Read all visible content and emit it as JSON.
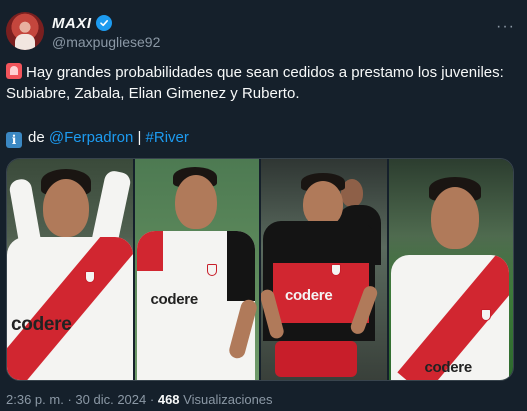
{
  "author": {
    "display_name": "MAXI",
    "handle": "@maxpugliese92",
    "verified_icon": "verified-badge-icon",
    "more_label": "···"
  },
  "tweet": {
    "siren_emoji": "rotating-light-emoji",
    "text": "Hay grandes probabilidades que sean cedidos a prestamo los juveniles: Subiabre, Zabala, Elian Gimenez y Ruberto.",
    "info_emoji": "i",
    "credit_prefix": "de",
    "credit_mention": "@Ferpadron",
    "credit_separator": "|",
    "credit_hashtag": "#River"
  },
  "media": {
    "sponsor": "codere"
  },
  "meta": {
    "time": "2:36 p. m.",
    "separator": "·",
    "date": "30 dic. 2024",
    "views_count": "468",
    "views_label": "Visualizaciones"
  },
  "colors": {
    "background": "#15202b",
    "link": "#1d9bf0",
    "secondary_text": "#8b98a5",
    "river_red": "#d12630"
  }
}
